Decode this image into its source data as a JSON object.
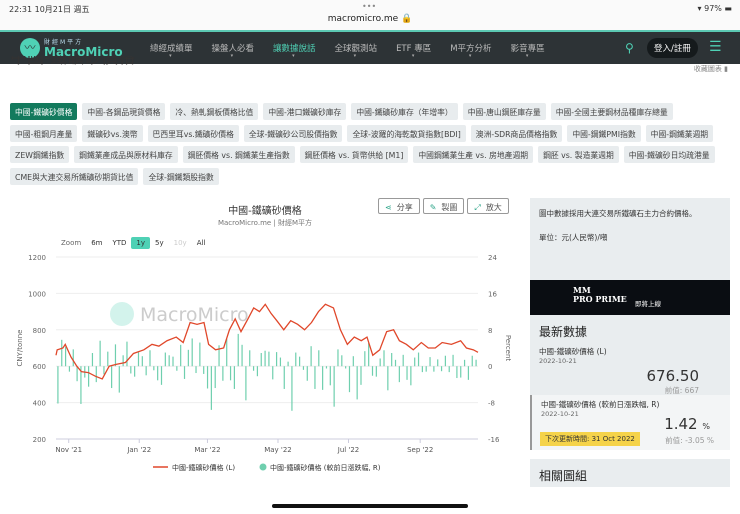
{
  "status_bar": {
    "time": "22:31  10月21日 週五",
    "dots": "•••",
    "url": "macromicro.me 🔒",
    "battery": "97%"
  },
  "nav": {
    "logo_small": "財經M平方",
    "logo_big": "MacroMicro",
    "items": [
      "總經成績單",
      "操盤人必看",
      "讓數據說話",
      "全球觀測站",
      "ETF 專區",
      "M平方分析",
      "影音專區"
    ],
    "active": 2,
    "login": "登入/註冊"
  },
  "page": {
    "title": "中國-鐵礦砂價格",
    "favorite": "收藏圖表"
  },
  "tags": [
    "中國-鐵礦砂價格",
    "中國-各鋼品現貨價格",
    "冷、熱軋鋼板價格比值",
    "中國-港口鐵礦砂庫存",
    "中國-鐵礦砂庫存（年增率）",
    "中國-唐山鋼胚庫存量",
    "中國-全國主要鋼材品種庫存總量",
    "中國-粗鋼月產量",
    "鐵礦砂vs.澳幣",
    "巴西里耳vs.鐵礦砂價格",
    "全球-鐵礦砂公司股價指數",
    "全球-波羅的海乾散貨指數[BDI]",
    "澳洲-SDR商品價格指數",
    "中國-鋼鐵PMI指數",
    "中國-鋼鐵業週期",
    "ZEW鋼鐵指數",
    "鋼鐵業產成品與原材料庫存",
    "鋼胚價格 vs. 鋼鐵業生產指數",
    "鋼胚價格 vs. 貨幣供給 [M1]",
    "中國鋼鐵業生產 vs. 房地產週期",
    "鋼胚 vs. 製造業週期",
    "中國-鐵礦砂日均疏港量",
    "CME與大連交易所鐵礦砂期貨比值",
    "全球-鋼鐵類股指數"
  ],
  "chart_buttons": {
    "share": "分享",
    "draw": "製圖",
    "expand": "放大"
  },
  "range": {
    "label": "Zoom",
    "options": [
      "6m",
      "YTD",
      "1y",
      "5y",
      "10y",
      "All"
    ],
    "selected": "1y"
  },
  "watermark": "MacroMicro",
  "chart_data": {
    "type": "line+bar",
    "title": "中國-鐵礦砂價格",
    "subtitle": "MacroMicro.me | 財經M平方",
    "ylabel": "CNY/tonne",
    "y2label": "Percent",
    "ylim": [
      200,
      1200
    ],
    "yticks": [
      "1200",
      "1000",
      "800",
      "600",
      "400",
      "200"
    ],
    "y2lim": [
      -16,
      24
    ],
    "y2ticks": [
      "24",
      "16",
      "8",
      "0",
      "-8",
      "-16"
    ],
    "xticks": [
      {
        "label": "Nov '21",
        "date": "2021-11-01"
      },
      {
        "label": "Jan '22",
        "date": "2022-01-01"
      },
      {
        "label": "Mar '22",
        "date": "2022-03-01"
      },
      {
        "label": "May '22",
        "date": "2022-05-01"
      },
      {
        "label": "Jul '22",
        "date": "2022-07-01"
      },
      {
        "label": "Sep '22",
        "date": "2022-09-01"
      }
    ],
    "xrange": [
      "2021-10-21",
      "2022-10-21"
    ],
    "series": [
      {
        "name": "中國-鐵礦砂價格 (L)",
        "color": "#e0472a",
        "type": "line",
        "points": [
          [
            "2021-10-21",
            660
          ],
          [
            "2021-10-22",
            690
          ],
          [
            "2021-10-27",
            700
          ],
          [
            "2021-10-29",
            720
          ],
          [
            "2021-11-03",
            650
          ],
          [
            "2021-11-08",
            600
          ],
          [
            "2021-11-12",
            570
          ],
          [
            "2021-11-18",
            565
          ],
          [
            "2021-11-24",
            545
          ],
          [
            "2021-11-30",
            530
          ],
          [
            "2021-12-06",
            600
          ],
          [
            "2021-12-12",
            610
          ],
          [
            "2021-12-20",
            620
          ],
          [
            "2021-12-27",
            670
          ],
          [
            "2022-01-05",
            690
          ],
          [
            "2022-01-12",
            720
          ],
          [
            "2022-01-18",
            710
          ],
          [
            "2022-01-25",
            740
          ],
          [
            "2022-02-02",
            760
          ],
          [
            "2022-02-08",
            730
          ],
          [
            "2022-02-14",
            840
          ],
          [
            "2022-02-20",
            830
          ],
          [
            "2022-02-26",
            840
          ],
          [
            "2022-03-02",
            720
          ],
          [
            "2022-03-08",
            690
          ],
          [
            "2022-03-15",
            700
          ],
          [
            "2022-03-20",
            800
          ],
          [
            "2022-03-25",
            860
          ],
          [
            "2022-03-30",
            790
          ],
          [
            "2022-04-05",
            860
          ],
          [
            "2022-04-10",
            920
          ],
          [
            "2022-04-15",
            900
          ],
          [
            "2022-04-20",
            940
          ],
          [
            "2022-04-25",
            890
          ],
          [
            "2022-04-30",
            850
          ],
          [
            "2022-05-06",
            800
          ],
          [
            "2022-05-12",
            850
          ],
          [
            "2022-05-18",
            830
          ],
          [
            "2022-05-24",
            800
          ],
          [
            "2022-05-30",
            840
          ],
          [
            "2022-06-05",
            900
          ],
          [
            "2022-06-11",
            940
          ],
          [
            "2022-06-18",
            920
          ],
          [
            "2022-06-24",
            800
          ],
          [
            "2022-06-30",
            720
          ],
          [
            "2022-07-06",
            760
          ],
          [
            "2022-07-12",
            740
          ],
          [
            "2022-07-17",
            760
          ],
          [
            "2022-07-22",
            660
          ],
          [
            "2022-07-28",
            690
          ],
          [
            "2022-08-03",
            790
          ],
          [
            "2022-08-09",
            800
          ],
          [
            "2022-08-14",
            740
          ],
          [
            "2022-08-20",
            720
          ],
          [
            "2022-08-26",
            690
          ],
          [
            "2022-09-02",
            730
          ],
          [
            "2022-09-08",
            700
          ],
          [
            "2022-09-14",
            700
          ],
          [
            "2022-09-20",
            730
          ],
          [
            "2022-09-28",
            720
          ],
          [
            "2022-10-06",
            740
          ],
          [
            "2022-10-11",
            700
          ],
          [
            "2022-10-17",
            690
          ],
          [
            "2022-10-21",
            676.5
          ]
        ]
      },
      {
        "name": "中國-鐵礦砂價格 (較前日漲跌幅, R)",
        "color": "#6fcfae",
        "type": "bar",
        "values": [
          -8.2,
          5.8,
          4.3,
          -1.2,
          3.7,
          -3.3,
          -8.3,
          -2.5,
          -4.5,
          2.9,
          -3.5,
          5.6,
          -1.8,
          3.2,
          -4.8,
          4.8,
          -5.8,
          2.4,
          5.4,
          -1.6,
          -2.3,
          3.1,
          2.2,
          -2.0,
          3.5,
          -0.9,
          -3.1,
          -4.1,
          3.0,
          2.4,
          2.1,
          -1.0,
          4.7,
          -2.8,
          3.6,
          6.1,
          -1.5,
          5.2,
          -1.7,
          -4.9,
          -9.6,
          -4.8,
          4.6,
          -3.2,
          6.0,
          -3.1,
          -5.0,
          7.1,
          4.7,
          -7.5,
          3.5,
          -1.0,
          -2.2,
          2.9,
          3.4,
          3.2,
          -2.9,
          3.1,
          1.9,
          -5.0,
          1.0,
          -9.8,
          3.0,
          2.1,
          -0.8,
          -3.2,
          4.4,
          -5.0,
          3.5,
          -5.2,
          -0.5,
          -4.2,
          -8.9,
          3.7,
          2.4,
          -0.5,
          -5.7,
          2.2,
          -7.3,
          -4.1,
          3.3,
          5.1,
          -2.1,
          -2.3,
          1.7,
          3.5,
          -5.3,
          2.9,
          1.4,
          -3.5,
          2.5,
          -3.0,
          -4.2,
          1.9,
          3.0,
          -1.3,
          -1.2,
          2.0,
          -1.2,
          1.5,
          -1.1,
          2.3,
          -1.3,
          2.5,
          -2.6,
          -2.5,
          1.4,
          -3.0,
          2.3,
          1.42
        ]
      }
    ]
  },
  "sidebar": {
    "note": "圖中數據採用大連交易所鐵礦石主力合約價格。",
    "unit": "單位：元(人民幣)/噸",
    "banner_mm": "MM",
    "banner_prime": "PRO PRIME",
    "banner_soon": "即將上線",
    "latest_title": "最新數據",
    "items": [
      {
        "label": "中國-鐵礦砂價格 (L)",
        "date": "2022-10-21",
        "value": "676.50",
        "prev": "前值: 667"
      },
      {
        "label": "中國-鐵礦砂價格 (較前日漲跌幅, R)",
        "date": "2022-10-21",
        "value": "1.42",
        "unit": "%",
        "prev": "前值: -3.05 %"
      }
    ],
    "next_update": "下次更新時間: 31 Oct 2022",
    "related": "相關圖組"
  }
}
